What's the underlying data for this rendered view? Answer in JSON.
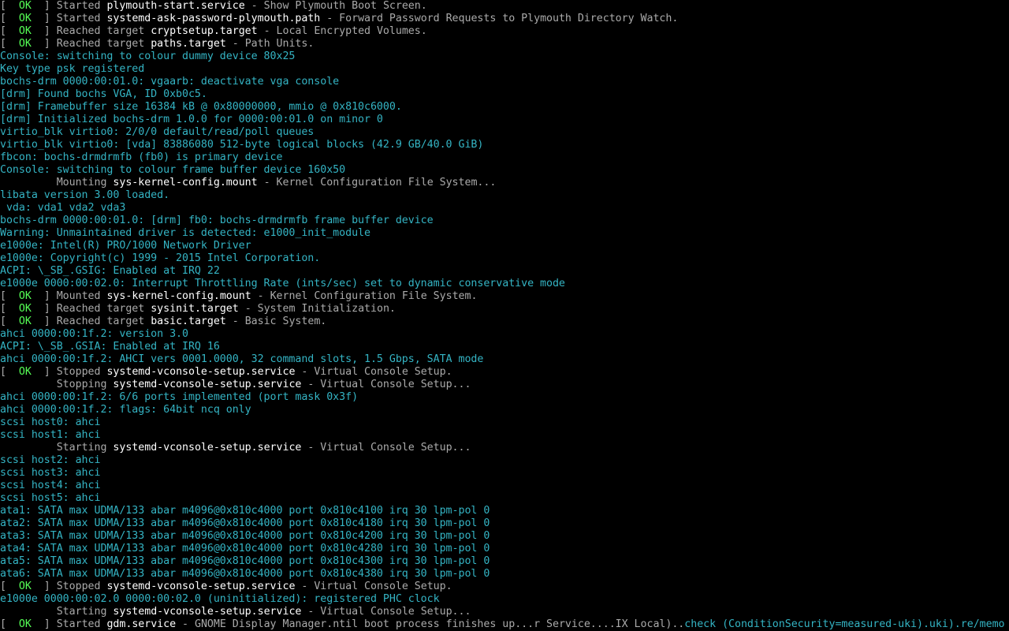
{
  "colors": {
    "background": "#000000",
    "ok_status": "#55ff55",
    "unit_name": "#ffffff",
    "systemd_text": "#aaaaaa",
    "kernel_text": "#34b4c4"
  },
  "lines": [
    {
      "kind": "status",
      "status": "OK",
      "pre": "Started ",
      "unit": "plymouth-start.service",
      "desc": " - Show Plymouth Boot Screen."
    },
    {
      "kind": "status",
      "status": "OK",
      "pre": "Started ",
      "unit": "systemd-ask-password-plymouth.path",
      "desc": " - Forward Password Requests to Plymouth Directory Watch."
    },
    {
      "kind": "status",
      "status": "OK",
      "pre": "Reached target ",
      "unit": "cryptsetup.target",
      "desc": " - Local Encrypted Volumes."
    },
    {
      "kind": "status",
      "status": "OK",
      "pre": "Reached target ",
      "unit": "paths.target",
      "desc": " - Path Units."
    },
    {
      "kind": "kernel",
      "text": "Console: switching to colour dummy device 80x25"
    },
    {
      "kind": "kernel",
      "text": "Key type psk registered"
    },
    {
      "kind": "kernel",
      "text": "bochs-drm 0000:00:01.0: vgaarb: deactivate vga console"
    },
    {
      "kind": "kernel",
      "text": "[drm] Found bochs VGA, ID 0xb0c5."
    },
    {
      "kind": "kernel",
      "text": "[drm] Framebuffer size 16384 kB @ 0x80000000, mmio @ 0x810c6000."
    },
    {
      "kind": "kernel",
      "text": "[drm] Initialized bochs-drm 1.0.0 for 0000:00:01.0 on minor 0"
    },
    {
      "kind": "kernel",
      "text": "virtio_blk virtio0: 2/0/0 default/read/poll queues"
    },
    {
      "kind": "kernel",
      "text": "virtio_blk virtio0: [vda] 83886080 512-byte logical blocks (42.9 GB/40.0 GiB)"
    },
    {
      "kind": "kernel",
      "text": "fbcon: bochs-drmdrmfb (fb0) is primary device"
    },
    {
      "kind": "kernel",
      "text": "Console: switching to colour frame buffer device 160x50"
    },
    {
      "kind": "action",
      "pre": "Mounting ",
      "unit": "sys-kernel-config.mount",
      "desc": " - Kernel Configuration File System..."
    },
    {
      "kind": "kernel",
      "text": "libata version 3.00 loaded."
    },
    {
      "kind": "kernel",
      "text": " vda: vda1 vda2 vda3"
    },
    {
      "kind": "kernel",
      "text": "bochs-drm 0000:00:01.0: [drm] fb0: bochs-drmdrmfb frame buffer device"
    },
    {
      "kind": "kernel",
      "text": "Warning: Unmaintained driver is detected: e1000_init_module"
    },
    {
      "kind": "kernel",
      "text": "e1000e: Intel(R) PRO/1000 Network Driver"
    },
    {
      "kind": "kernel",
      "text": "e1000e: Copyright(c) 1999 - 2015 Intel Corporation."
    },
    {
      "kind": "kernel",
      "text": "ACPI: \\_SB_.GSIG: Enabled at IRQ 22"
    },
    {
      "kind": "kernel",
      "text": "e1000e 0000:00:02.0: Interrupt Throttling Rate (ints/sec) set to dynamic conservative mode"
    },
    {
      "kind": "status",
      "status": "OK",
      "pre": "Mounted ",
      "unit": "sys-kernel-config.mount",
      "desc": " - Kernel Configuration File System."
    },
    {
      "kind": "status",
      "status": "OK",
      "pre": "Reached target ",
      "unit": "sysinit.target",
      "desc": " - System Initialization."
    },
    {
      "kind": "status",
      "status": "OK",
      "pre": "Reached target ",
      "unit": "basic.target",
      "desc": " - Basic System."
    },
    {
      "kind": "kernel",
      "text": "ahci 0000:00:1f.2: version 3.0"
    },
    {
      "kind": "kernel",
      "text": "ACPI: \\_SB_.GSIA: Enabled at IRQ 16"
    },
    {
      "kind": "kernel",
      "text": "ahci 0000:00:1f.2: AHCI vers 0001.0000, 32 command slots, 1.5 Gbps, SATA mode"
    },
    {
      "kind": "status",
      "status": "OK",
      "pre": "Stopped ",
      "unit": "systemd-vconsole-setup.service",
      "desc": " - Virtual Console Setup."
    },
    {
      "kind": "action",
      "pre": "Stopping ",
      "unit": "systemd-vconsole-setup.service",
      "desc": " - Virtual Console Setup..."
    },
    {
      "kind": "kernel",
      "text": "ahci 0000:00:1f.2: 6/6 ports implemented (port mask 0x3f)"
    },
    {
      "kind": "kernel",
      "text": "ahci 0000:00:1f.2: flags: 64bit ncq only"
    },
    {
      "kind": "kernel",
      "text": "scsi host0: ahci"
    },
    {
      "kind": "kernel",
      "text": "scsi host1: ahci"
    },
    {
      "kind": "action",
      "pre": "Starting ",
      "unit": "systemd-vconsole-setup.service",
      "desc": " - Virtual Console Setup..."
    },
    {
      "kind": "kernel",
      "text": "scsi host2: ahci"
    },
    {
      "kind": "kernel",
      "text": "scsi host3: ahci"
    },
    {
      "kind": "kernel",
      "text": "scsi host4: ahci"
    },
    {
      "kind": "kernel",
      "text": "scsi host5: ahci"
    },
    {
      "kind": "kernel",
      "text": "ata1: SATA max UDMA/133 abar m4096@0x810c4000 port 0x810c4100 irq 30 lpm-pol 0"
    },
    {
      "kind": "kernel",
      "text": "ata2: SATA max UDMA/133 abar m4096@0x810c4000 port 0x810c4180 irq 30 lpm-pol 0"
    },
    {
      "kind": "kernel",
      "text": "ata3: SATA max UDMA/133 abar m4096@0x810c4000 port 0x810c4200 irq 30 lpm-pol 0"
    },
    {
      "kind": "kernel",
      "text": "ata4: SATA max UDMA/133 abar m4096@0x810c4000 port 0x810c4280 irq 30 lpm-pol 0"
    },
    {
      "kind": "kernel",
      "text": "ata5: SATA max UDMA/133 abar m4096@0x810c4000 port 0x810c4300 irq 30 lpm-pol 0"
    },
    {
      "kind": "kernel",
      "text": "ata6: SATA max UDMA/133 abar m4096@0x810c4000 port 0x810c4380 irq 30 lpm-pol 0"
    },
    {
      "kind": "status",
      "status": "OK",
      "pre": "Stopped ",
      "unit": "systemd-vconsole-setup.service",
      "desc": " - Virtual Console Setup."
    },
    {
      "kind": "kernel",
      "text": "e1000e 0000:00:02.0 0000:00:02.0 (uninitialized): registered PHC clock"
    },
    {
      "kind": "action",
      "pre": "Starting ",
      "unit": "systemd-vconsole-setup.service",
      "desc": " - Virtual Console Setup..."
    },
    {
      "kind": "status",
      "status": "OK",
      "pre": "Started ",
      "unit": "gdm.service",
      "desc": " - GNOME Display Manager.ntil boot process finishes up...r Service....IX Local)..",
      "tail": "check (ConditionSecurity=measured-uki).uki).re/memo"
    }
  ]
}
